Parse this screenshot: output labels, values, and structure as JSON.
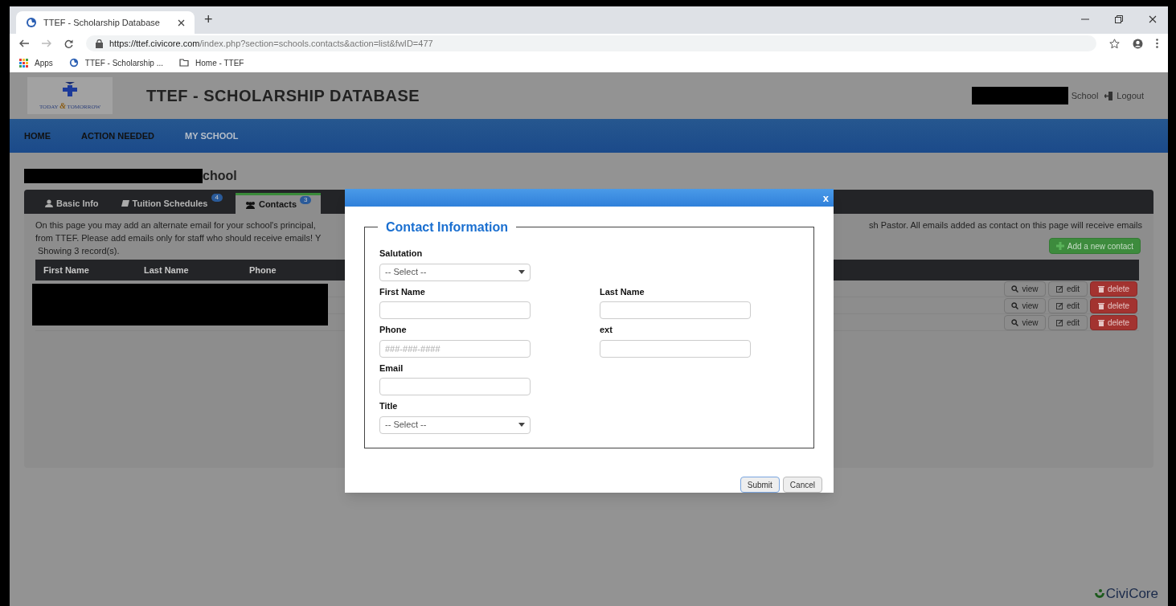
{
  "browser": {
    "tab_title": "TTEF - Scholarship Database",
    "new_tab": "+",
    "url_host": "https://ttef.civicore.com",
    "url_path": "/index.php?section=schools.contacts&action=list&fwID=477",
    "bookmarks": [
      {
        "label": "Apps",
        "kind": "apps"
      },
      {
        "label": "TTEF - Scholarship ...",
        "kind": "site"
      },
      {
        "label": "Home - TTEF",
        "kind": "folder"
      }
    ]
  },
  "header": {
    "logo_text": "TODAY & TOMORROW",
    "title": "TTEF - SCHOLARSHIP DATABASE",
    "user": "School",
    "logout": "Logout"
  },
  "nav": [
    {
      "label": "HOME",
      "selected": false
    },
    {
      "label": "ACTION NEEDED",
      "selected": false
    },
    {
      "label": "MY SCHOOL",
      "selected": true
    }
  ],
  "school_name": "chool",
  "tabs": [
    {
      "label": "Basic Info",
      "selected": false
    },
    {
      "label": "Tuition Schedules",
      "badge": "4",
      "selected": false
    },
    {
      "label": "Contacts",
      "badge": "3",
      "selected": true
    }
  ],
  "intro_left": [
    "On this page you may add an alternate email for your school's principal,",
    "from TTEF. Please add emails only for staff who should receive emails! Y"
  ],
  "intro_right": "sh Pastor. All emails added as contact on this page will receive emails",
  "records": "Showing 3 record(s).",
  "add_button": "Add a new contact",
  "table": {
    "columns": [
      "First Name",
      "Last Name",
      "Phone"
    ],
    "rows": [
      {
        "actions": [
          "view",
          "edit",
          "delete"
        ]
      },
      {
        "actions": [
          "view",
          "edit",
          "delete"
        ]
      },
      {
        "actions": [
          "view",
          "edit",
          "delete"
        ]
      }
    ]
  },
  "modal": {
    "close": "x",
    "legend": "Contact Information",
    "rows": [
      [
        {
          "label": "Salutation",
          "kind": "select",
          "value": "-- Select --"
        }
      ],
      [
        {
          "label": "First Name",
          "kind": "text"
        },
        {
          "label": "Last Name",
          "kind": "text"
        }
      ],
      [
        {
          "label": "Phone",
          "kind": "text",
          "placeholder": "###-###-####"
        },
        {
          "label": "ext",
          "kind": "text"
        }
      ],
      [
        {
          "label": "Email",
          "kind": "text"
        }
      ],
      [
        {
          "label": "Title",
          "kind": "select",
          "value": "-- Select --"
        }
      ]
    ],
    "buttons": [
      {
        "label": "Submit",
        "focused": true
      },
      {
        "label": "Cancel",
        "focused": false
      }
    ]
  },
  "footer_brand": "CiviCore"
}
